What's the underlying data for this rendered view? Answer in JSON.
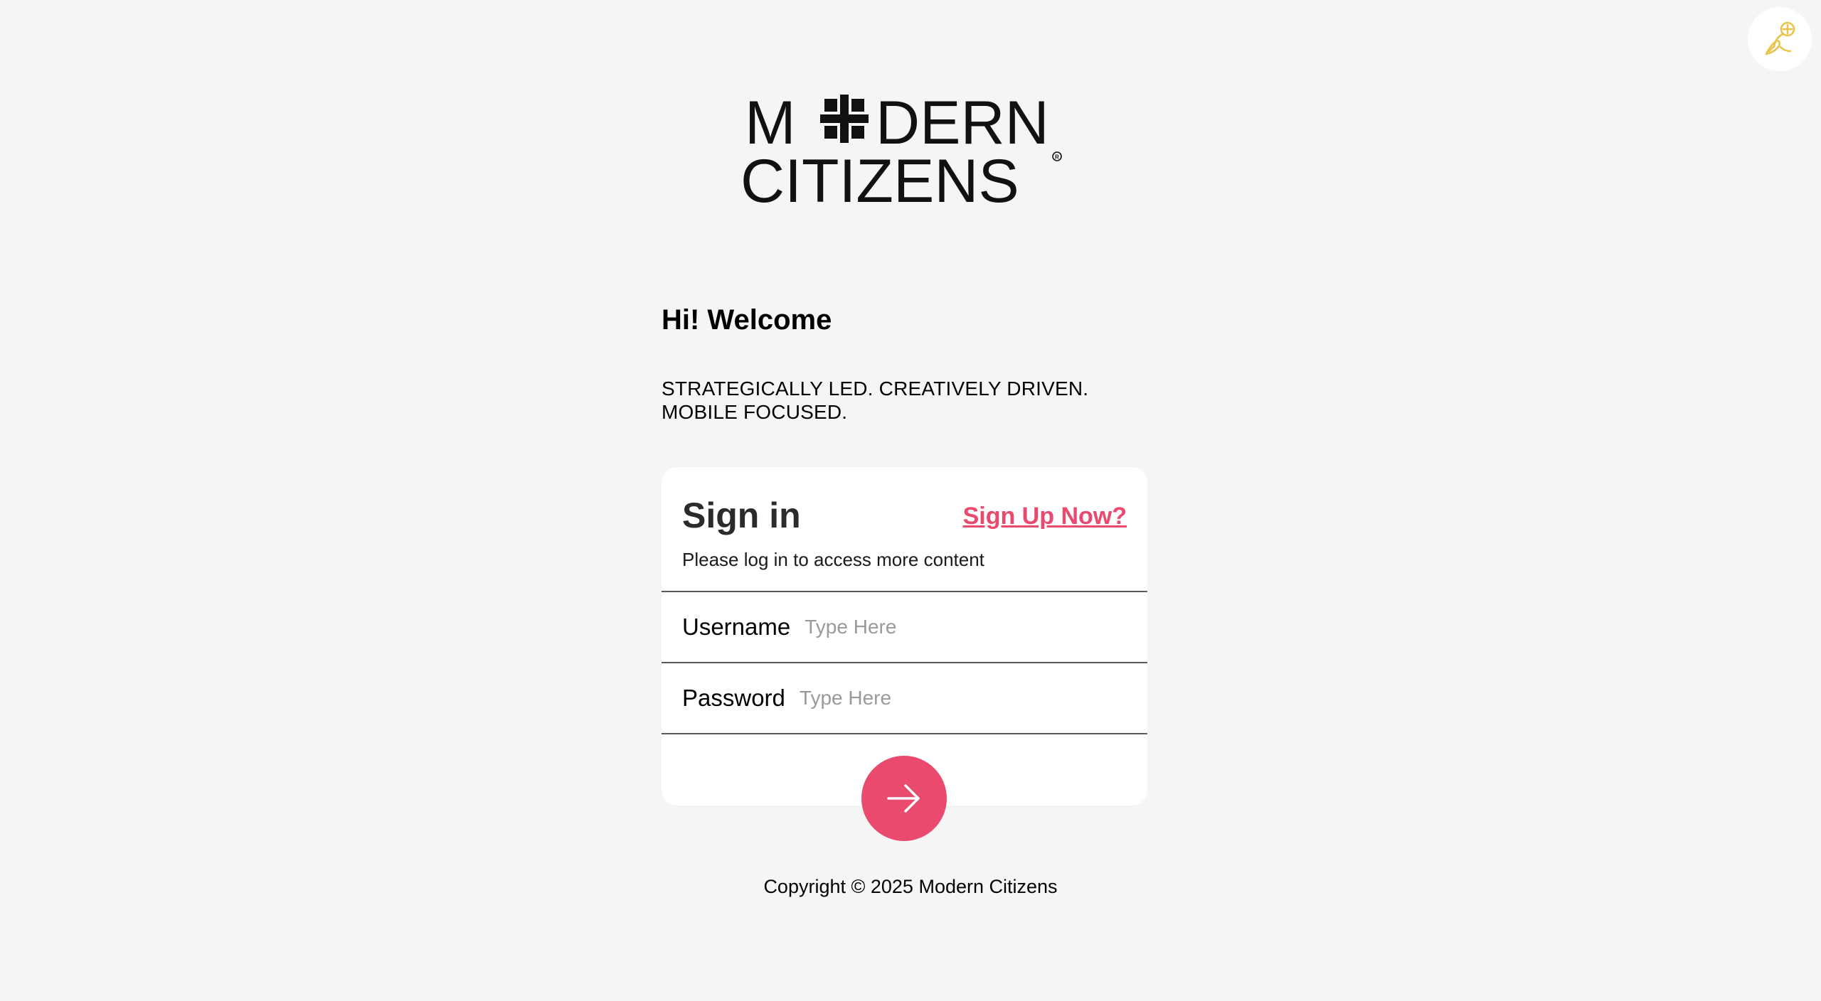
{
  "brand": {
    "logo_line1": "MODERN",
    "logo_line2": "CITIZENS"
  },
  "welcome": {
    "title": "Hi! Welcome",
    "tagline_line1": "STRATEGICALLY LED. CREATIVELY DRIVEN.",
    "tagline_line2": "MOBILE FOCUSED."
  },
  "signin": {
    "title": "Sign in",
    "signup_link": "Sign Up Now?",
    "subtitle": "Please log in to access more content",
    "username_label": "Username",
    "username_placeholder": "Type Here",
    "password_label": "Password",
    "password_placeholder": "Type Here",
    "submit_icon": "arrow-right-icon"
  },
  "footer": {
    "copyright": "Copyright © 2025 Modern Citizens"
  },
  "widget": {
    "icon": "pen-nib-icon"
  },
  "colors": {
    "background": "#f5f5f5",
    "accent": "#ea4a6d",
    "card": "#ffffff",
    "widget_icon": "#e8c44a"
  }
}
